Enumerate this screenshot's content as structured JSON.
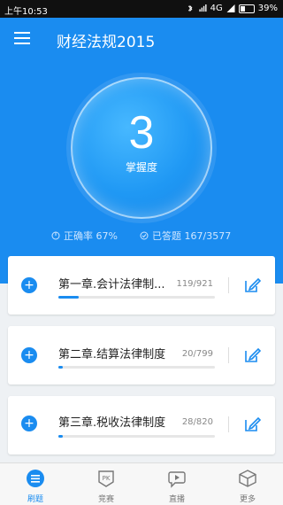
{
  "status": {
    "time": "上午10:53",
    "network": "4G",
    "battery": "39%"
  },
  "header": {
    "title": "财经法规2015"
  },
  "score": {
    "value": "3",
    "label": "掌握度"
  },
  "stats": {
    "accuracy": "正确率 67%",
    "answered": "已答题 167/3577"
  },
  "chapters": [
    {
      "title": "第一章.会计法律制...",
      "count": "119/921",
      "progress": 0.13
    },
    {
      "title": "第二章.结算法律制度",
      "count": "20/799",
      "progress": 0.03
    },
    {
      "title": "第三章.税收法律制度",
      "count": "28/820",
      "progress": 0.03
    }
  ],
  "tabs": [
    {
      "label": "刷题",
      "icon": "list-icon"
    },
    {
      "label": "竞赛",
      "icon": "pk-icon"
    },
    {
      "label": "直播",
      "icon": "live-icon"
    },
    {
      "label": "更多",
      "icon": "box-icon"
    }
  ],
  "colors": {
    "accent": "#1a8cf0"
  }
}
